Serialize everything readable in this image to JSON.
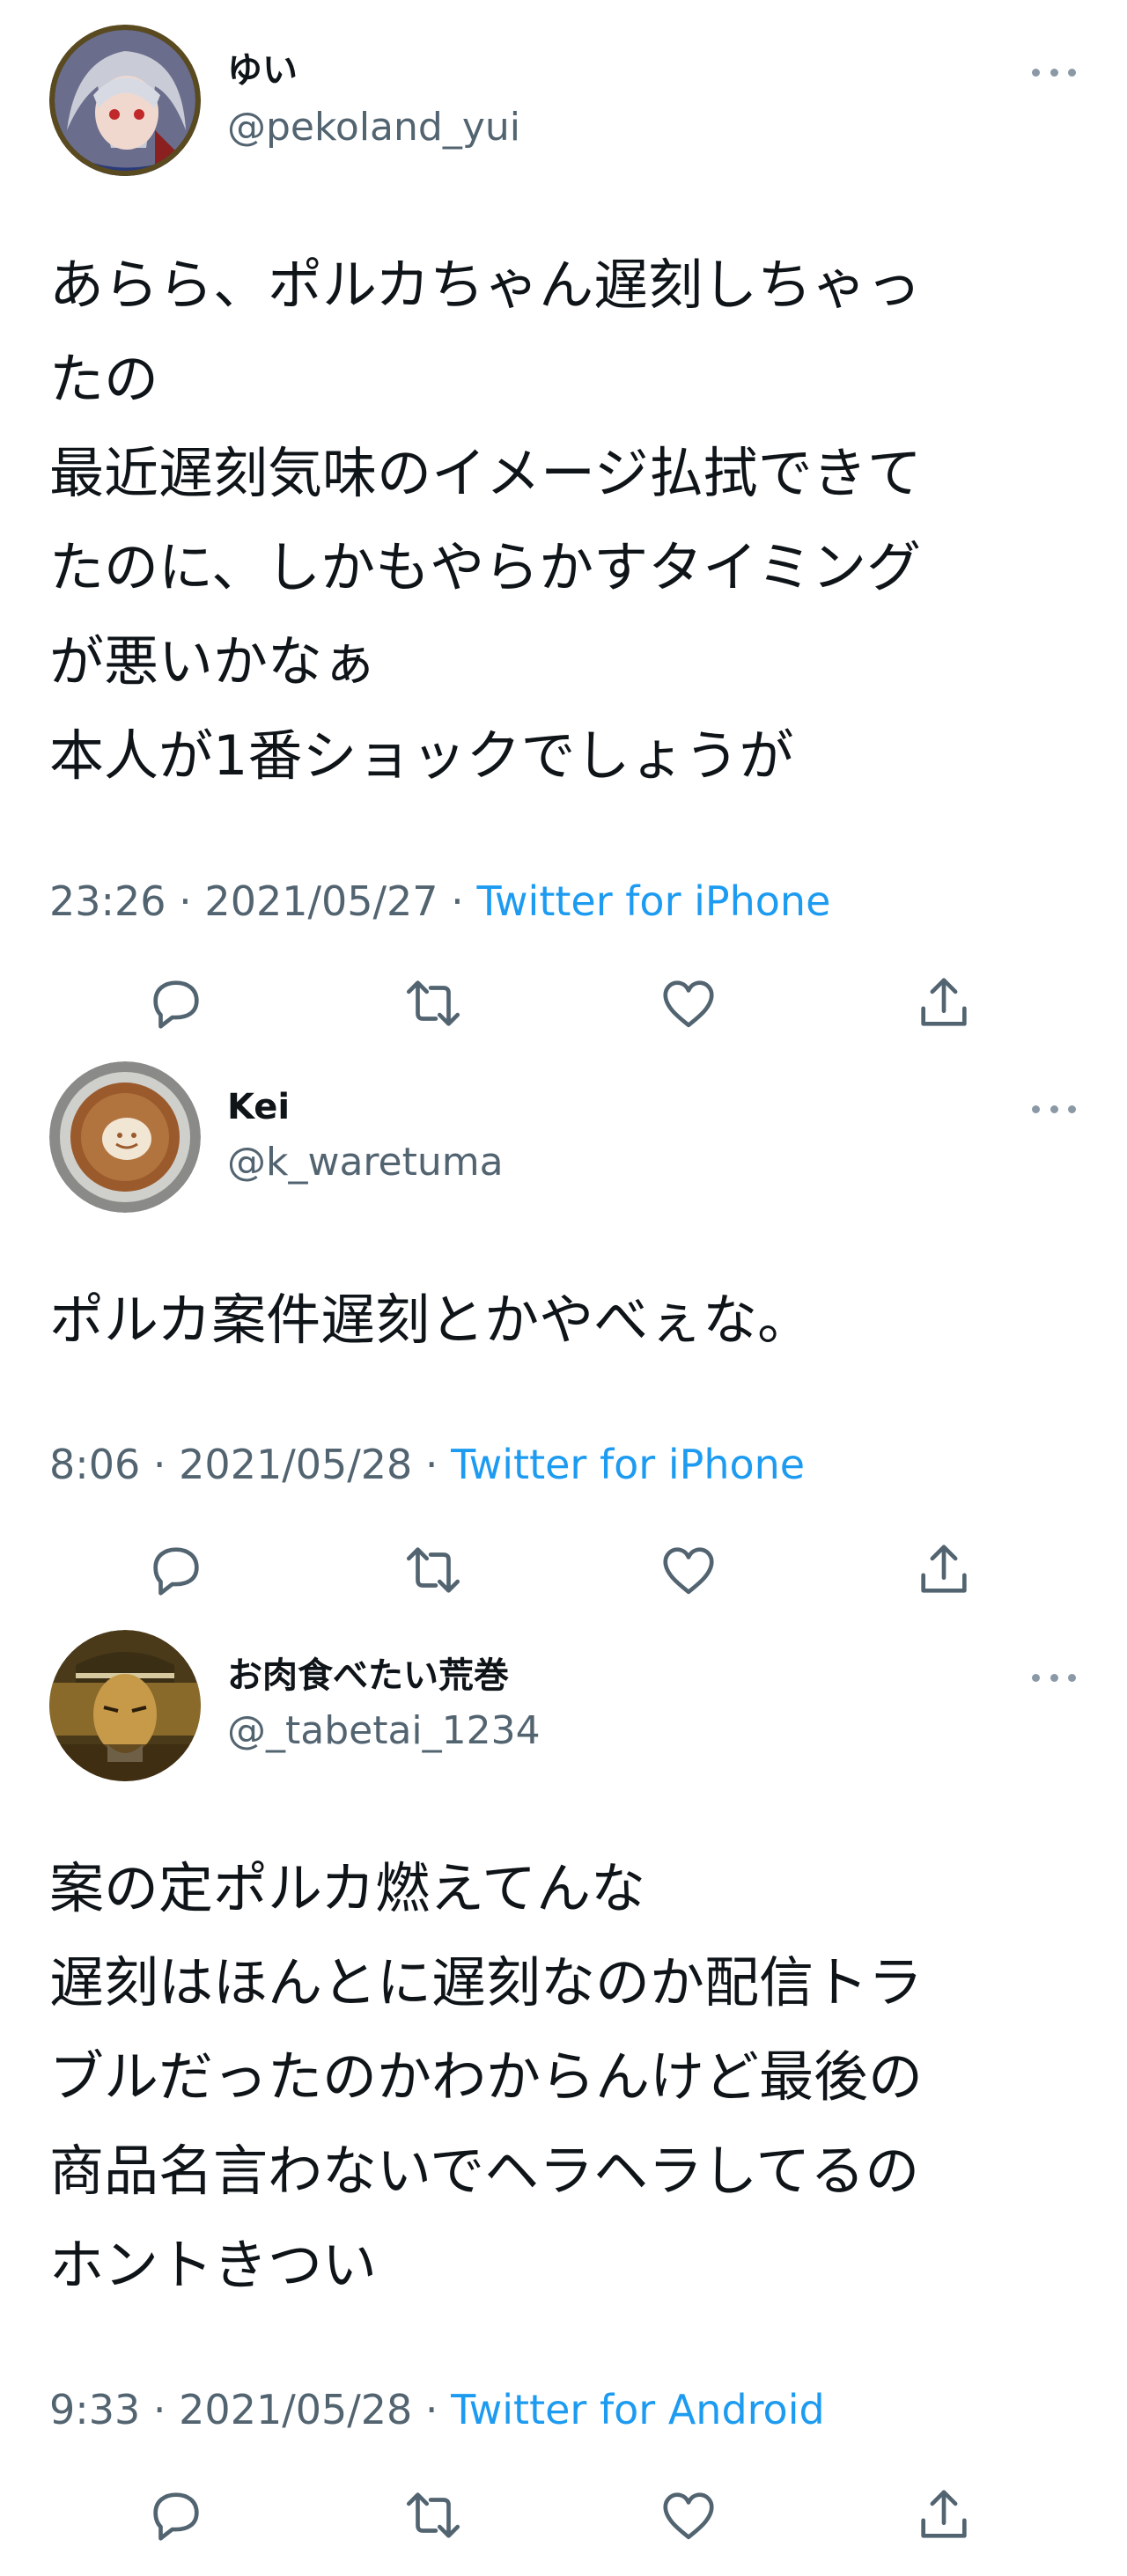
{
  "tweets": [
    {
      "name": "ゆい",
      "handle": "@pekoland_yui",
      "lines": [
        "あらら、ポルカちゃん遅刻しちゃっ",
        "たの",
        "最近遅刻気味のイメージ払拭できて",
        "たのに、しかもやらかすタイミング",
        "が悪いかなぁ",
        "本人が1番ショックでしょうが"
      ],
      "time": "23:26 · 2021/05/27 · ",
      "source": "Twitter for iPhone"
    },
    {
      "name": "Kei",
      "handle": "@k_waretuma",
      "lines": [
        "ポルカ案件遅刻とかやべぇな。"
      ],
      "time": "8:06 · 2021/05/28 · ",
      "source": "Twitter for iPhone"
    },
    {
      "name": "お肉食べたい荒巻",
      "handle": "@_tabetai_1234",
      "lines": [
        "案の定ポルカ燃えてんな",
        "遅刻はほんとに遅刻なのか配信トラ",
        "ブルだったのかわからんけど最後の",
        "商品名言わないでヘラヘラしてるの",
        "ホントきつい"
      ],
      "time": "9:33 · 2021/05/28 · ",
      "source": "Twitter for Android"
    }
  ],
  "icons": [
    "reply-icon",
    "retweet-icon",
    "like-icon",
    "share-icon",
    "more-icon"
  ],
  "colors": {
    "text": "#0f1419",
    "muted": "#536471",
    "link": "#1d9bf0",
    "icon": "#536471"
  }
}
